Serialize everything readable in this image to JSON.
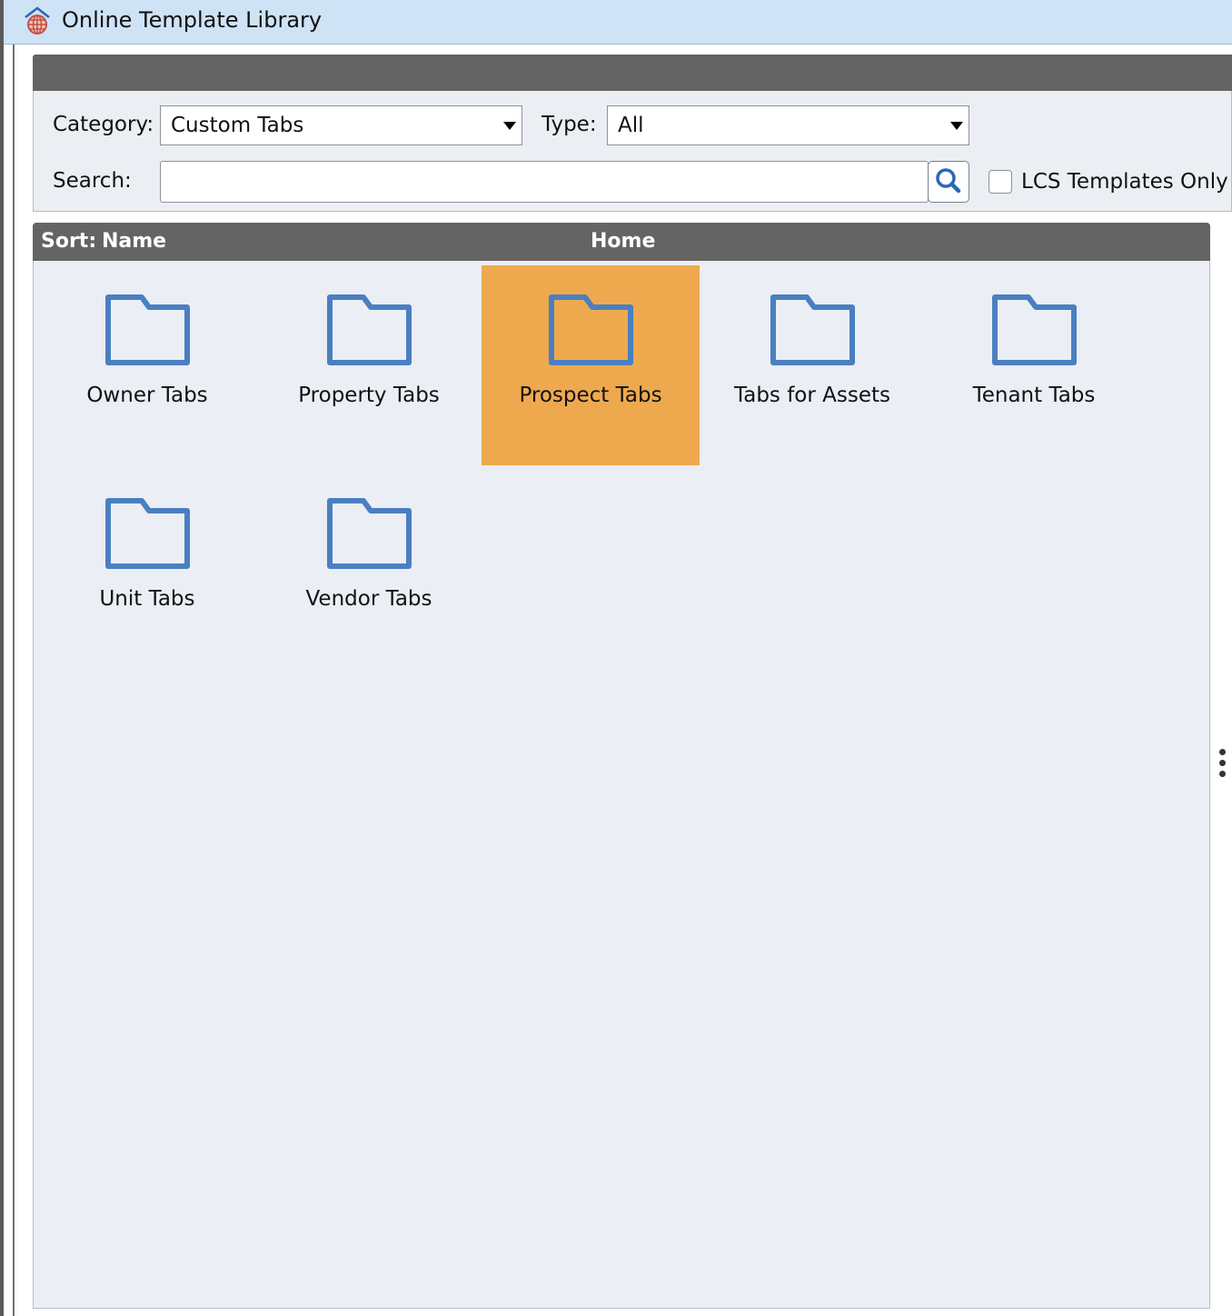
{
  "window": {
    "title": "Online Template Library"
  },
  "filters": {
    "category_label": "Category:",
    "category_value": "Custom Tabs",
    "type_label": "Type:",
    "type_value": "All",
    "search_label": "Search:",
    "search_value": "",
    "search_placeholder": "",
    "lcs_only_label": "LCS Templates Only",
    "lcs_only_checked": false
  },
  "sort_bar": {
    "sort_label": "Sort:",
    "sort_value": "Name",
    "location": "Home"
  },
  "folders": [
    {
      "label": "Owner Tabs",
      "selected": false
    },
    {
      "label": "Property Tabs",
      "selected": false
    },
    {
      "label": "Prospect Tabs",
      "selected": true
    },
    {
      "label": "Tabs for Assets",
      "selected": false
    },
    {
      "label": "Tenant Tabs",
      "selected": false
    },
    {
      "label": "Unit Tabs",
      "selected": false
    },
    {
      "label": "Vendor Tabs",
      "selected": false
    }
  ],
  "colors": {
    "titlebar": "#cfe3f7",
    "header_bar": "#646464",
    "panel_bg": "#ebeef4",
    "folder_icon": "#4a7fc1",
    "selection": "#eea94f"
  },
  "icons": {
    "app": "library-globe-icon",
    "search": "magnifier-icon",
    "folder": "folder-icon",
    "dropdown": "chevron-down-icon",
    "splitter": "vertical-ellipsis-icon"
  }
}
